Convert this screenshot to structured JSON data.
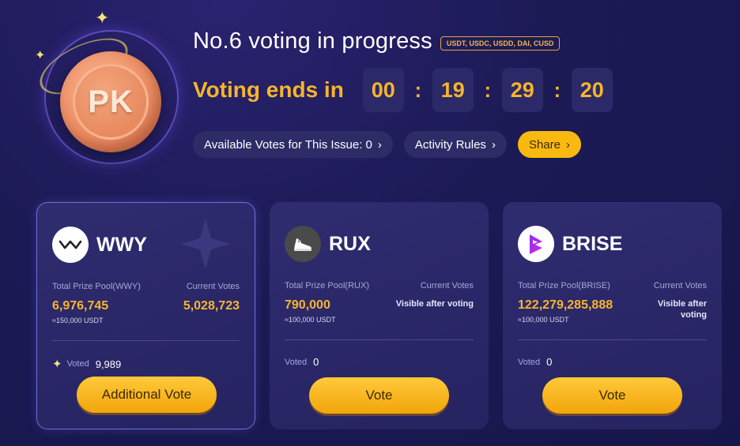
{
  "header": {
    "badge_text": "PK",
    "title": "No.6  voting in progress",
    "tokens": "USDT, USDC, USDD, DAI, CUSD",
    "ends_label": "Voting ends in",
    "countdown": [
      "00",
      "19",
      "29",
      "20"
    ],
    "colon": ":"
  },
  "actions": {
    "available_votes": "Available Votes for This Issue: 0",
    "activity_rules": "Activity Rules",
    "share": "Share",
    "chevron": "›"
  },
  "cards": [
    {
      "name": "WWY",
      "logo_icon": "wwy-logo-icon",
      "pool_label": "Total Prize Pool(WWY)",
      "votes_label": "Current Votes",
      "pool_value": "6,976,745",
      "pool_usdt": "≈150,000 USDT",
      "current_votes": "5,028,723",
      "voted_label": "Voted",
      "voted_value": "9,989",
      "button": "Additional Vote"
    },
    {
      "name": "RUX",
      "logo_icon": "rux-logo-icon",
      "pool_label": "Total Prize Pool(RUX)",
      "votes_label": "Current Votes",
      "pool_value": "790,000",
      "pool_usdt": "≈100,000 USDT",
      "current_votes": "Visible after voting",
      "voted_label": "Voted",
      "voted_value": "0",
      "button": "Vote"
    },
    {
      "name": "BRISE",
      "logo_icon": "brise-logo-icon",
      "pool_label": "Total Prize Pool(BRISE)",
      "votes_label": "Current Votes",
      "pool_value": "122,279,285,888",
      "pool_usdt": "≈100,000 USDT",
      "current_votes": "Visible after voting",
      "voted_label": "Voted",
      "voted_value": "0",
      "button": "Vote"
    }
  ],
  "colors": {
    "accent": "#f7b52c",
    "background": "#1c1a55",
    "card": "#2a2768"
  }
}
